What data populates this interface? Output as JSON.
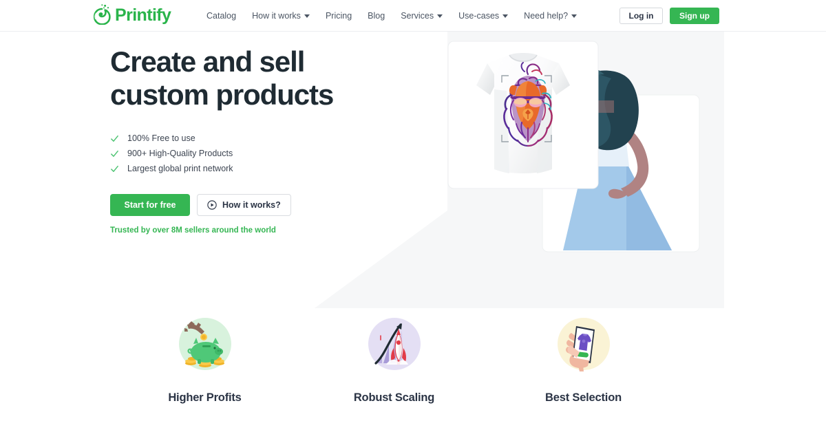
{
  "brand": {
    "name": "Printify",
    "logo_icon": "printify-paint-splash-icon",
    "color": "#2ab44b"
  },
  "header": {
    "nav": [
      {
        "label": "Catalog",
        "has_dropdown": false
      },
      {
        "label": "How it works",
        "has_dropdown": true
      },
      {
        "label": "Pricing",
        "has_dropdown": false
      },
      {
        "label": "Blog",
        "has_dropdown": false
      },
      {
        "label": "Services",
        "has_dropdown": true
      },
      {
        "label": "Use-cases",
        "has_dropdown": true
      },
      {
        "label": "Need help?",
        "has_dropdown": true
      }
    ],
    "login_label": "Log in",
    "signup_label": "Sign up",
    "signup_color": "#35b653"
  },
  "hero": {
    "title_line1": "Create and sell",
    "title_line2": "custom products",
    "bullets": [
      {
        "icon": "check-icon",
        "text": "100% Free to use"
      },
      {
        "icon": "check-icon",
        "text": "900+ High-Quality Products"
      },
      {
        "icon": "check-icon",
        "text": "Largest global print network"
      }
    ],
    "primary_cta": "Start for free",
    "secondary_cta": "How it works?",
    "secondary_cta_icon": "play-circle-icon",
    "trusted_text": "Trusted by over 8M sellers around the world",
    "trusted_color": "#35b653",
    "illustration": {
      "description": "Woman pointing at a white t-shirt with a colorful lion design on a product card",
      "tshirt_design": "colorful-lion-with-sunglasses",
      "shirt_color": "#ffffff",
      "hair_color": "#22424f",
      "skin_color": "#b08383",
      "dress_color": "#a3c9ea",
      "backdrop_color": "#f5f6f7"
    }
  },
  "features": [
    {
      "title": "Higher Profits",
      "icon": "piggy-bank-coin-icon",
      "circle_color": "#d8f2dd",
      "accent_color": "#4fc878"
    },
    {
      "title": "Robust Scaling",
      "icon": "rocket-growth-chart-icon",
      "circle_color": "#e4dff4",
      "accent_color": "#8d7fd0"
    },
    {
      "title": "Best Selection",
      "icon": "hand-phone-tshirt-icon",
      "circle_color": "#faf3d5",
      "accent_color": "#6b4fc4"
    }
  ]
}
